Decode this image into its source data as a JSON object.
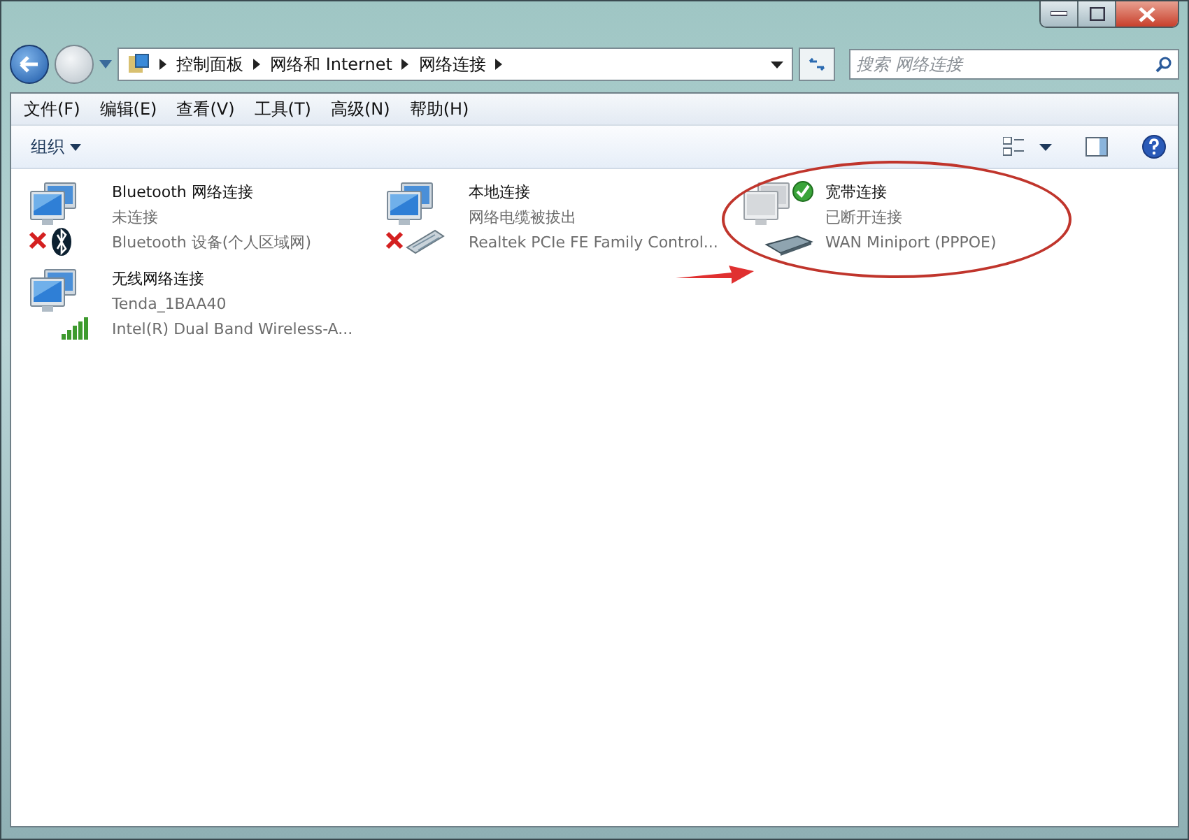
{
  "address_bar": {
    "crumbs": [
      "控制面板",
      "网络和 Internet",
      "网络连接"
    ]
  },
  "search": {
    "placeholder": "搜索 网络连接"
  },
  "menu_bar": [
    "文件(F)",
    "编辑(E)",
    "查看(V)",
    "工具(T)",
    "高级(N)",
    "帮助(H)"
  ],
  "command_bar": {
    "organize": "组织"
  },
  "connections": [
    {
      "name": "Bluetooth 网络连接",
      "status": "未连接",
      "device": "Bluetooth 设备(个人区域网)",
      "kind": "bluetooth",
      "error": true,
      "ok": false,
      "highlighted": false
    },
    {
      "name": "本地连接",
      "status": "网络电缆被拔出",
      "device": "Realtek PCIe FE Family Control...",
      "kind": "wired",
      "error": true,
      "ok": false,
      "highlighted": false
    },
    {
      "name": "宽带连接",
      "status": "已断开连接",
      "device": "WAN Miniport (PPPOE)",
      "kind": "pppoe",
      "error": false,
      "ok": true,
      "highlighted": true
    },
    {
      "name": "无线网络连接",
      "status": "Tenda_1BAA40",
      "device": "Intel(R) Dual Band Wireless-A...",
      "kind": "wireless",
      "error": false,
      "ok": false,
      "highlighted": false
    }
  ]
}
